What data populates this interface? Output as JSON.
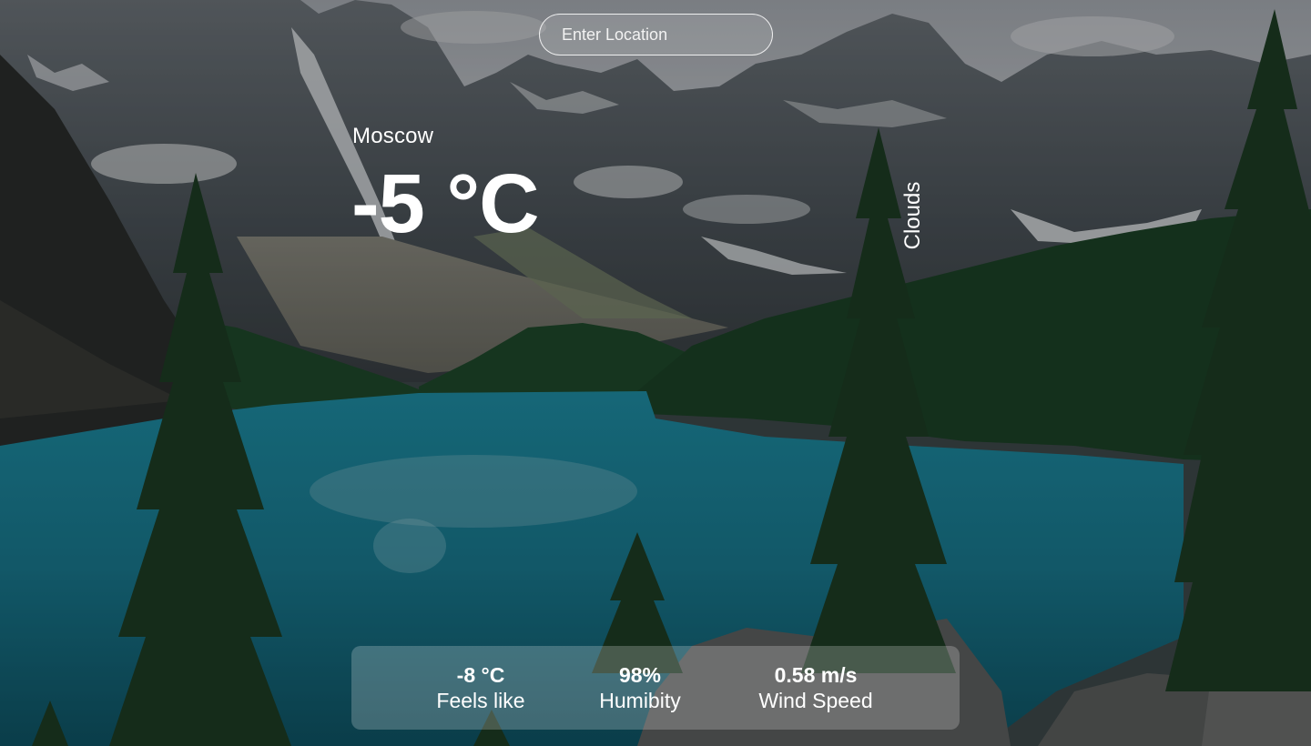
{
  "search": {
    "placeholder": "Enter Location",
    "value": ""
  },
  "weather": {
    "city": "Moscow",
    "temperature": "-5 °C",
    "condition": "Clouds"
  },
  "stats": {
    "feels_like": {
      "value": "-8 °C",
      "label": "Feels like"
    },
    "humidity": {
      "value": "98%",
      "label": "Humibity"
    },
    "wind": {
      "value": "0.58 m/s",
      "label": "Wind Speed"
    }
  },
  "colors": {
    "text": "#ffffff",
    "lake": "#1b7f95",
    "forest": "#1c3d26",
    "sky": "#b8bcc2"
  },
  "background": {
    "description_icon": "mountain-lake-scene"
  }
}
